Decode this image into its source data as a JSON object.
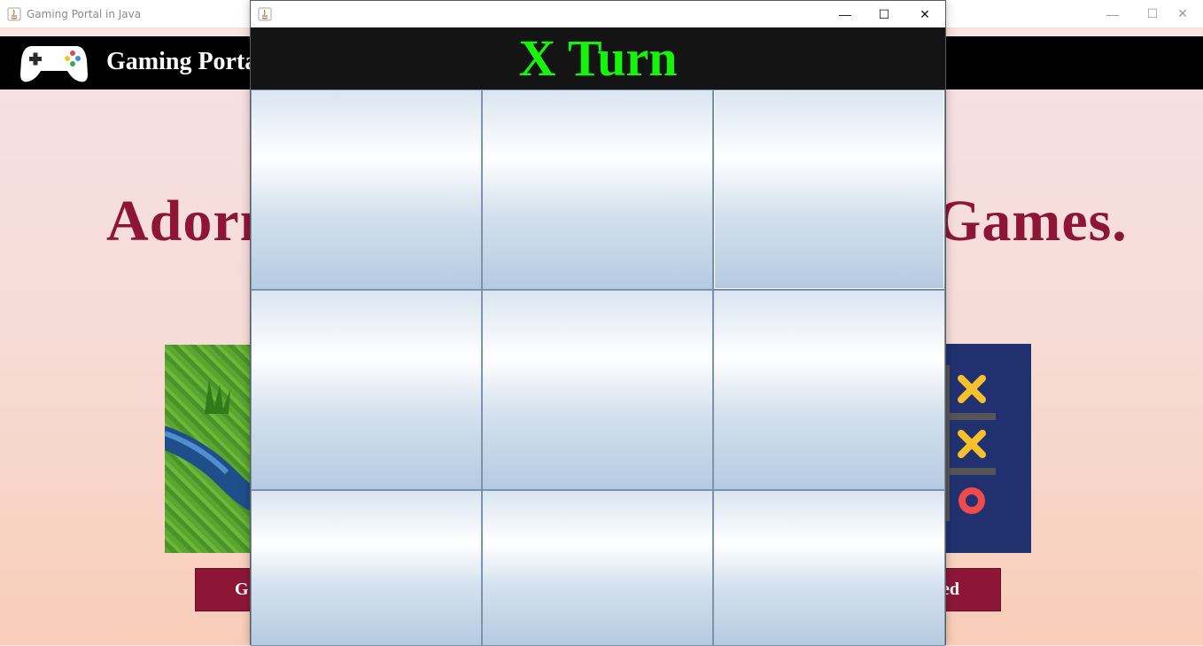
{
  "main_window": {
    "title": "Gaming Portal in Java",
    "header_title": "Gaming Portal",
    "hero_left": "Adorn",
    "hero_right": "Games.",
    "button_left": "G",
    "button_right": "ed",
    "header_bg": "#000000",
    "accent": "#8d1637"
  },
  "game_window": {
    "title": "",
    "turn_text": "X Turn",
    "turn_color": "#16f30d",
    "cells": [
      "",
      "",
      "",
      "",
      "",
      "",
      "",
      "",
      ""
    ]
  },
  "window_controls": {
    "minimize": "—",
    "maximize": "☐",
    "close": "✕"
  }
}
